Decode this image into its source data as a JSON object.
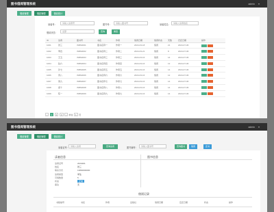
{
  "app": {
    "title": "图书借阅管理系统",
    "user_label": "admin",
    "caret": "▾"
  },
  "tabs": [
    "借阅管理",
    "借还管理",
    "借阅统计"
  ],
  "panel1": {
    "filters": {
      "reader_label": "读者号：",
      "reader_placeholder": "请输入读者号",
      "book_label": "图书号：",
      "book_placeholder": "请输入图书号",
      "reader_name_label": "读者姓名：",
      "reader_name_placeholder": "请输入读者姓名",
      "status_label": "借阅状态：",
      "status_value": "全部",
      "search_label": "查询",
      "reset_label": "重置"
    },
    "table": {
      "columns": [
        "ID",
        "读者",
        "图书号",
        "书名",
        "作者",
        "借阅日期",
        "借阅状态",
        "天数",
        "归还日期",
        "操作"
      ],
      "rows": [
        [
          "1001",
          "张三",
          "ISBN0001",
          "图书名称一",
          "作者一",
          "2024-03-18",
          "借阅",
          "21",
          "2024-07-06"
        ],
        [
          "1002",
          "李四",
          "ISBN0002",
          "图书名称二",
          "作者二",
          "2024-03-21",
          "借阅",
          "8",
          "2024-07-06"
        ],
        [
          "1003",
          "王五",
          "ISBN0003",
          "图书名称三",
          "作者三",
          "2024-03-16",
          "借阅",
          "14",
          "2024-07-06"
        ],
        [
          "1004",
          "赵六",
          "ISBN0004",
          "图书名称四",
          "作者四",
          "2024-03-16",
          "借阅",
          "12",
          "2024-07-06"
        ],
        [
          "1005",
          "孙七",
          "ISBN0005",
          "图书名称五",
          "作者五",
          "2024-03-16",
          "借阅",
          "14",
          "2024-07-06"
        ],
        [
          "1006",
          "周八",
          "ISBN0006",
          "图书名称六",
          "作者六",
          "2024-03-16",
          "借阅",
          "12",
          "2024-07-06"
        ],
        [
          "1007",
          "吴九",
          "ISBN0007",
          "图书名称七",
          "作者七",
          "2024-03-16",
          "借阅",
          "14",
          "2024-07-06"
        ],
        [
          "1008",
          "郑十",
          "ISBN0008",
          "图书名称八",
          "作者八",
          "2024-03-16",
          "借阅",
          "14",
          "2024-07-06"
        ],
        [
          "1009",
          "陈一",
          "ISBN0009",
          "图书名称九",
          "作者九",
          "2024-03-16",
          "借阅",
          "14",
          "2024-07-06"
        ]
      ]
    },
    "pager": [
      "‹",
      "1",
      "2",
      "3",
      "›",
      "前往",
      "1",
      "页"
    ]
  },
  "panel2": {
    "tabs": [
      "借阅管理",
      "借还管理",
      "借阅统计"
    ],
    "filters": {
      "reader_label": "读者证号：",
      "reader_value": "请输入读者",
      "query_label": "查询读者",
      "book_label": "图书编号：",
      "book_placeholder": "请输入图书号",
      "book_query_label": "查询图书",
      "borrow_label": "借阅",
      "return_label": "还书"
    },
    "reader_info": {
      "title": "读者信息",
      "fields": [
        {
          "label": "读者证号",
          "value": "2024001"
        },
        {
          "label": "姓名",
          "value": "张三"
        },
        {
          "label": "联系方式",
          "value": "13800000000"
        },
        {
          "label": "读者类型",
          "value": "学生"
        },
        {
          "label": "可借数量",
          "value": "5"
        },
        {
          "label": "状态",
          "value": "正常"
        },
        {
          "label": "备注",
          "value": "无"
        }
      ]
    },
    "book_info": {
      "title": "图书信息"
    },
    "records": {
      "title": "借阅记录",
      "columns": [
        "书籍编号",
        "书名",
        "作者",
        "出版社",
        "借阅日期",
        "应还日期",
        "状态",
        "操作"
      ]
    }
  }
}
